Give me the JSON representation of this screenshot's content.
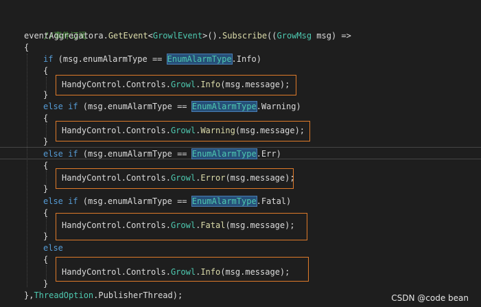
{
  "code": {
    "comment": "//事件订阅",
    "l1": {
      "a": "eventAggregatora",
      "b": ".",
      "c": "GetEvent",
      "d": "<",
      "e": "GrowlEvent",
      "f": ">().",
      "g": "Subscribe",
      "h": "((",
      "i": "GrowMsg",
      "j": " msg) =>"
    },
    "open": "{",
    "close": "}",
    "kw_if": "if",
    "kw_elseif": "else if",
    "kw_else": "else",
    "cond_pre": " (msg.enumAlarmType == ",
    "enum_type": "EnumAlarmType",
    "values": [
      "Info",
      "Warning",
      "Err",
      "Fatal"
    ],
    "call_ns": "HandyControl.Controls.",
    "call_cls": "Growl",
    "methods": [
      "Info",
      "Warning",
      "Error",
      "Fatal",
      "Info"
    ],
    "call_args": "(msg.message);",
    "end_pre": "},",
    "end_type": "ThreadOption",
    "end_post": ".PublisherThread);"
  },
  "watermark": "CSDN @code bean",
  "colors": {
    "background": "#1e1e1e",
    "keyword": "#569cd6",
    "type": "#4ec9b0",
    "method": "#dcdcaa",
    "comment": "#57a64a",
    "highlight_box": "#e07b2a"
  }
}
